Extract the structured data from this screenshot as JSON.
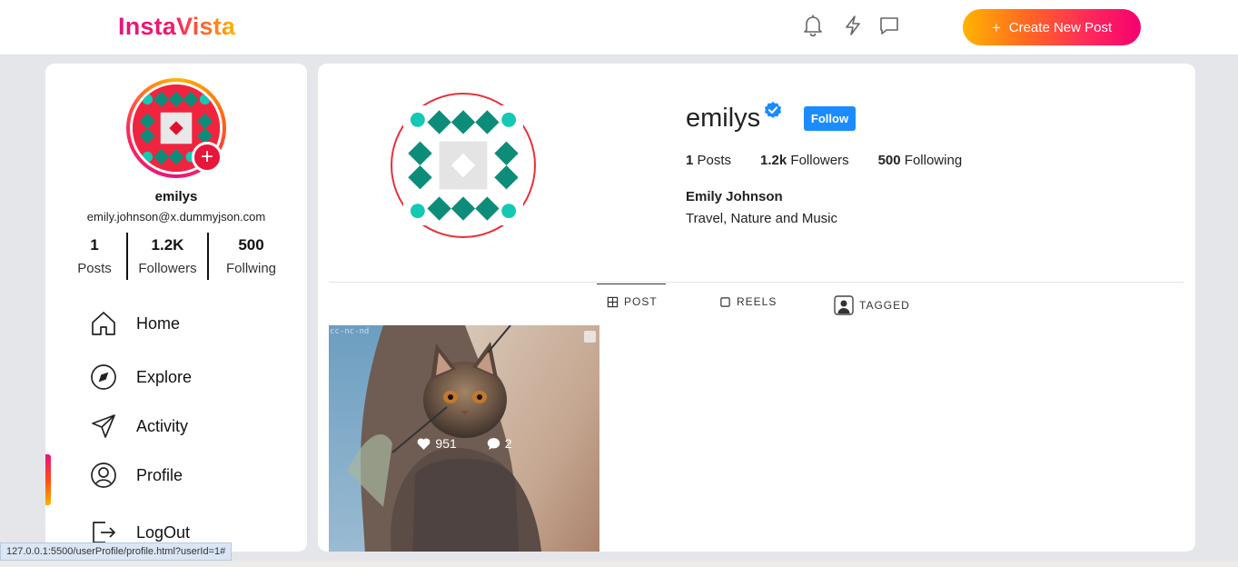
{
  "header": {
    "logo": "InstaVista",
    "create_button": "Create New Post",
    "create_icon": "+",
    "icons": [
      "bell-icon",
      "lightning-icon",
      "chat-icon"
    ]
  },
  "sidebar": {
    "username": "emilys",
    "email": "emily.johnson@x.dummyjson.com",
    "add_icon": "+",
    "stats": [
      {
        "value": "1",
        "label": "Posts"
      },
      {
        "value": "1.2K",
        "label": "Followers"
      },
      {
        "value": "500",
        "label": "Follwing"
      }
    ],
    "nav": [
      {
        "label": "Home",
        "icon": "home-icon"
      },
      {
        "label": "Explore",
        "icon": "compass-icon"
      },
      {
        "label": "Activity",
        "icon": "send-icon"
      },
      {
        "label": "Profile",
        "icon": "user-icon"
      },
      {
        "label": "LogOut",
        "icon": "logout-icon"
      }
    ]
  },
  "profile": {
    "username": "emilys",
    "follow_label": "Follow",
    "posts_count": "1",
    "posts_label": "Posts",
    "followers_count": "1.2k",
    "followers_label": "Followers",
    "following_count": "500",
    "following_label": "Following",
    "full_name": "Emily Johnson",
    "bio": "Travel, Nature and Music"
  },
  "tabs": [
    {
      "label": "POST",
      "icon": "grid-icon",
      "active": true
    },
    {
      "label": "REELS",
      "icon": "square-icon",
      "active": false
    },
    {
      "label": "TAGGED",
      "icon": "user-tag-icon",
      "active": false
    }
  ],
  "posts": [
    {
      "likes": "951",
      "comments": "2",
      "watermark": "cc-nc-nd"
    }
  ],
  "status_bar": {
    "url": "127.0.0.1:5500/userProfile/profile.html?userId=1#"
  },
  "colors": {
    "accent_gradient_start": "#ffb400",
    "accent_gradient_end": "#f5006f",
    "follow_blue": "#1a8cff",
    "verified_blue": "#1a8cff"
  }
}
